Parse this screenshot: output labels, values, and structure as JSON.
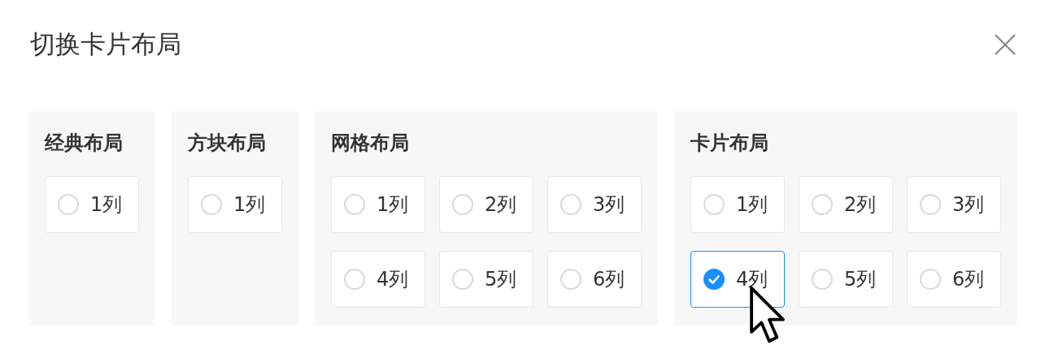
{
  "dialog": {
    "title": "切换卡片布局",
    "groups": [
      {
        "title": "经典布局",
        "options": [
          {
            "label": "1列",
            "selected": false
          }
        ]
      },
      {
        "title": "方块布局",
        "options": [
          {
            "label": "1列",
            "selected": false
          }
        ]
      },
      {
        "title": "网格布局",
        "options": [
          {
            "label": "1列",
            "selected": false
          },
          {
            "label": "2列",
            "selected": false
          },
          {
            "label": "3列",
            "selected": false
          },
          {
            "label": "4列",
            "selected": false
          },
          {
            "label": "5列",
            "selected": false
          },
          {
            "label": "6列",
            "selected": false
          }
        ]
      },
      {
        "title": "卡片布局",
        "options": [
          {
            "label": "1列",
            "selected": false
          },
          {
            "label": "2列",
            "selected": false
          },
          {
            "label": "3列",
            "selected": false
          },
          {
            "label": "4列",
            "selected": true
          },
          {
            "label": "5列",
            "selected": false
          },
          {
            "label": "6列",
            "selected": false
          }
        ]
      }
    ]
  }
}
